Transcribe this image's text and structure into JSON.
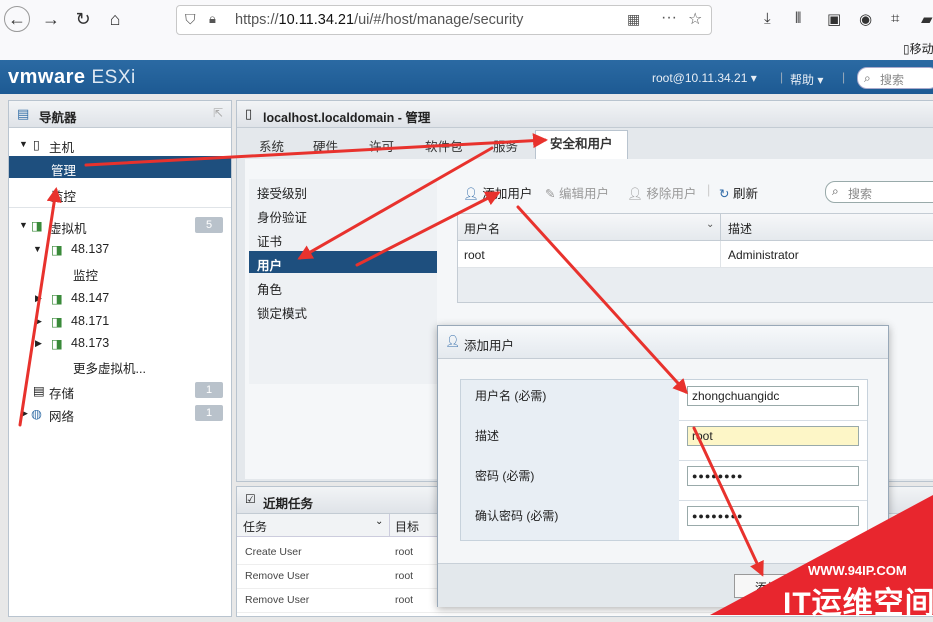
{
  "browser": {
    "url_scheme": "https://",
    "url_host": "10.11.34.21",
    "url_path": "/ui/#/host/manage/security",
    "ext_label": "移动"
  },
  "header": {
    "logo_vm": "vmware",
    "logo_product": "ESXi",
    "user": "root@10.11.34.21 ▾",
    "help": "帮助 ▾",
    "search_placeholder": "搜索"
  },
  "navigator": {
    "title": "导航器",
    "items": [
      {
        "label": "主机"
      },
      {
        "label": "管理"
      },
      {
        "label": "监控"
      },
      {
        "label": "虚拟机",
        "badge": "5"
      },
      {
        "label": "48.137"
      },
      {
        "label": "监控"
      },
      {
        "label": "48.147"
      },
      {
        "label": "48.171"
      },
      {
        "label": "48.173"
      },
      {
        "label": "更多虚拟机..."
      },
      {
        "label": "存储",
        "badge": "1"
      },
      {
        "label": "网络",
        "badge": "1"
      }
    ]
  },
  "manage": {
    "title": "localhost.localdomain - 管理",
    "tabs": [
      "系统",
      "硬件",
      "许可",
      "软件包",
      "服务",
      "安全和用户"
    ],
    "left_menu": [
      "接受级别",
      "身份验证",
      "证书",
      "用户",
      "角色",
      "锁定模式"
    ],
    "toolbar": {
      "add_user": "添加用户",
      "edit_user": "编辑用户",
      "remove_user": "移除用户",
      "refresh": "刷新",
      "search_placeholder": "搜索"
    },
    "grid": {
      "columns": [
        "用户名",
        "描述"
      ],
      "rows": [
        {
          "username": "root",
          "description": "Administrator"
        }
      ]
    }
  },
  "tasks": {
    "title": "近期任务",
    "columns": [
      "任务",
      "目标"
    ],
    "rows": [
      {
        "task": "Create User",
        "target": "root"
      },
      {
        "task": "Remove User",
        "target": "root"
      },
      {
        "task": "Remove User",
        "target": "root"
      }
    ]
  },
  "dialog": {
    "title": "添加用户",
    "fields": [
      {
        "label": "用户名 (必需)",
        "value": "zhongchuangidc"
      },
      {
        "label": "描述",
        "value": "root"
      },
      {
        "label": "密码 (必需)",
        "value": "●●●●●●●●"
      },
      {
        "label": "确认密码 (必需)",
        "value": "●●●●●●●●"
      }
    ],
    "add_button": "添加"
  },
  "watermark": {
    "url": "WWW.94IP.COM",
    "brand": "IT运维空间"
  },
  "colors": {
    "header_blue": "#1d5a93",
    "selected": "#1e4f7e",
    "arrow": "#e8322d"
  }
}
